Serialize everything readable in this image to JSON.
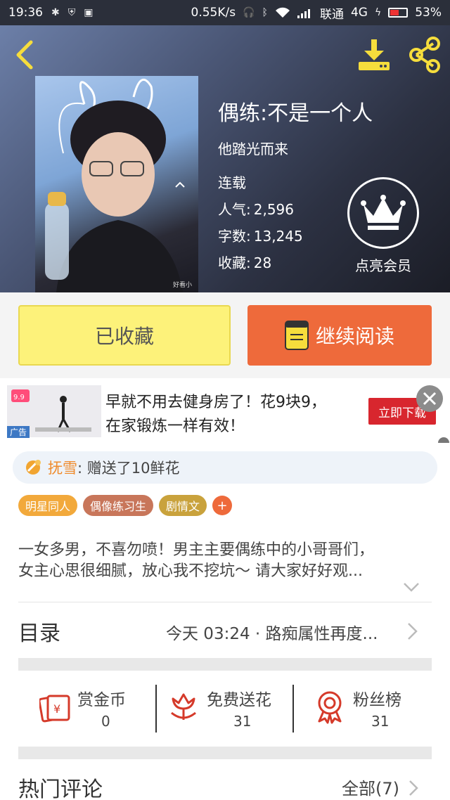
{
  "status_bar": {
    "time": "19:36",
    "speed": "0.55K/s",
    "carrier": "联通",
    "network": "4G",
    "battery": "53%"
  },
  "book": {
    "title": "偶练:不是一个人",
    "author": "他踏光而来",
    "status": "连载",
    "popularity_label": "人气:",
    "popularity": "2,596",
    "words_label": "字数:",
    "words": "13,245",
    "favorites_label": "收藏:",
    "favorites": "28",
    "cover_watermark": "好看小"
  },
  "vip": {
    "label": "点亮会员"
  },
  "actions": {
    "favorited_label": "已收藏",
    "continue_label": "继续阅读"
  },
  "ad": {
    "line1": "早就不用去健身房了！花9块9，",
    "line2": "在家锻炼一样有效！",
    "cta": "立即下载",
    "tag": "广告",
    "price_badge": "9.9"
  },
  "gift": {
    "user": "抚雪",
    "message": ": 赠送了10鲜花"
  },
  "tags": [
    {
      "label": "明星同人",
      "color": "#f2a93b"
    },
    {
      "label": "偶像练习生",
      "color": "#c8765a"
    },
    {
      "label": "剧情文",
      "color": "#c9a23c"
    }
  ],
  "tag_add": "+",
  "description": {
    "line1": "一女多男，不喜勿喷！男主主要偶练中的小哥哥们，",
    "line2": "女主心思很细腻，放心我不挖坑～      请大家好好观..."
  },
  "toc": {
    "label": "目录",
    "latest": "今天 03:24 · 路痴属性再度..."
  },
  "stats": [
    {
      "label": "赏金币",
      "value": "0"
    },
    {
      "label": "免费送花",
      "value": "31"
    },
    {
      "label": "粉丝榜",
      "value": "31"
    }
  ],
  "comments": {
    "title": "热门评论",
    "all": "全部(7)"
  },
  "colors": {
    "accent_orange": "#ee6a3b",
    "favorite_yellow": "#fdf27a",
    "icon_red": "#d53a2a"
  }
}
